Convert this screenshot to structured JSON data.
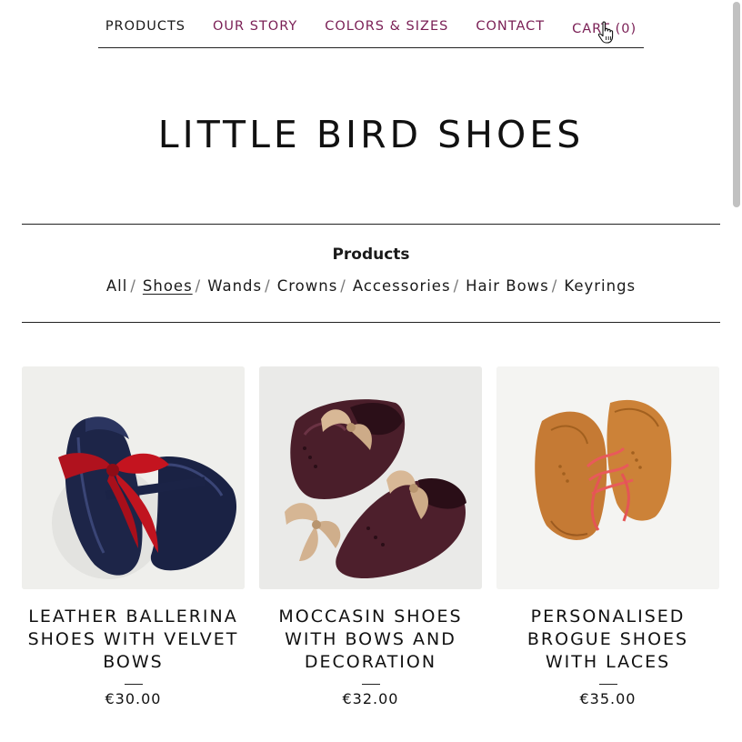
{
  "nav": {
    "products": "PRODUCTS",
    "our_story": "OUR STORY",
    "colors_sizes": "COLORS & SIZES",
    "contact": "CONTACT",
    "cart": "CART (0)"
  },
  "site_title": "LITTLE BIRD SHOES",
  "filter": {
    "heading": "Products",
    "categories": [
      "All",
      "Shoes",
      "Wands",
      "Crowns",
      "Accessories",
      "Hair Bows",
      "Keyrings"
    ],
    "separator": "/",
    "active": "Shoes"
  },
  "products": [
    {
      "name": "LEATHER BALLERINA SHOES WITH VELVET BOWS",
      "price": "€30.00"
    },
    {
      "name": "MOCCASIN SHOES WITH BOWS AND DECORATION",
      "price": "€32.00"
    },
    {
      "name": "PERSONALISED BROGUE SHOES WITH LACES",
      "price": "€35.00"
    }
  ],
  "colors": {
    "nav_accent": "#7a1f55",
    "text": "#111111"
  },
  "icons": {
    "cursor": "hand-pointer-icon"
  }
}
